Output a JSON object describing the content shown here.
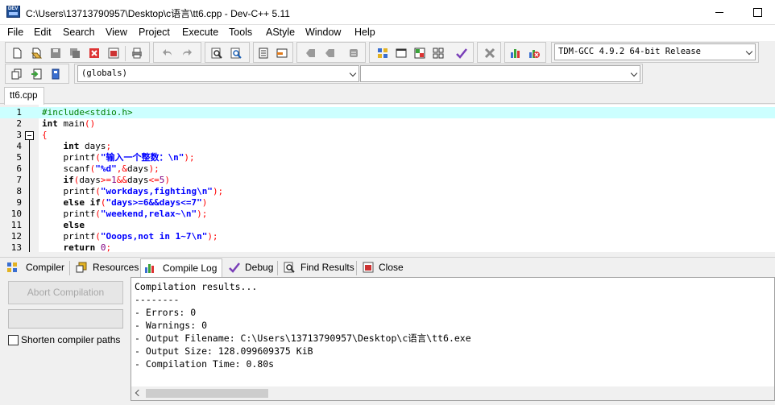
{
  "window": {
    "title": "C:\\Users\\13713790957\\Desktop\\c语言\\tt6.cpp - Dev-C++ 5.11",
    "logo_text": "DEV"
  },
  "menu": [
    "File",
    "Edit",
    "Search",
    "View",
    "Project",
    "Execute",
    "Tools",
    "AStyle",
    "Window",
    "Help"
  ],
  "toolbar": {
    "compiler": "TDM-GCC 4.9.2 64-bit Release",
    "class_combo": "(globals)",
    "member_combo": ""
  },
  "editor": {
    "tab_label": "tt6.cpp",
    "current_line": 1,
    "lines": [
      "1",
      "2",
      "3",
      "4",
      "5",
      "6",
      "7",
      "8",
      "9",
      "10",
      "11",
      "12",
      "13"
    ]
  },
  "bottom_tabs": [
    "Compiler",
    "Resources",
    "Compile Log",
    "Debug",
    "Find Results",
    "Close"
  ],
  "active_bottom_tab": "Compile Log",
  "compile_panel": {
    "abort_label": "Abort Compilation",
    "shorten_label": "Shorten compiler paths",
    "shorten_checked": false
  },
  "log": [
    "Compilation results...",
    "--------",
    "- Errors: 0",
    "- Warnings: 0",
    "- Output Filename: C:\\Users\\13713790957\\Desktop\\c语言\\tt6.exe",
    "- Output Size: 128.099609375 KiB",
    "- Compilation Time: 0.80s"
  ],
  "colors": {
    "current_line": "#ccffff",
    "keyword": "#000000",
    "string": "#0000ff",
    "number": "#800080",
    "operator": "#ff0000",
    "preprocessor": "#008000"
  }
}
